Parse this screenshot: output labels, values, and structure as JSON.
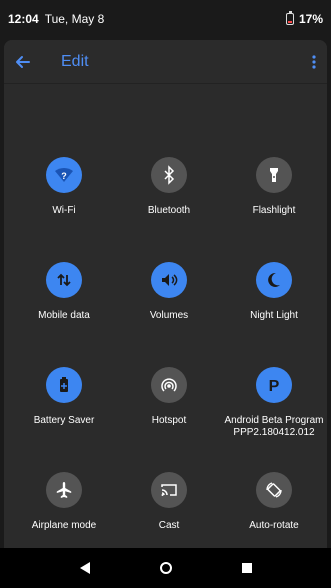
{
  "status_bar": {
    "time": "12:04",
    "date": "Tue, May 8",
    "battery": "17%"
  },
  "toolbar": {
    "title": "Edit"
  },
  "tiles": [
    {
      "label": "Wi-Fi",
      "icon": "wifi-icon",
      "active": true
    },
    {
      "label": "Bluetooth",
      "icon": "bluetooth-icon",
      "active": false
    },
    {
      "label": "Flashlight",
      "icon": "flashlight-icon",
      "active": false
    },
    {
      "label": "Mobile data",
      "icon": "mobile-data-icon",
      "active": true
    },
    {
      "label": "Volumes",
      "icon": "volume-icon",
      "active": true
    },
    {
      "label": "Night Light",
      "icon": "night-light-icon",
      "active": true
    },
    {
      "label": "Battery Saver",
      "icon": "battery-saver-icon",
      "active": true
    },
    {
      "label": "Hotspot",
      "icon": "hotspot-icon",
      "active": false
    },
    {
      "label": "Android Beta Program",
      "sublabel": "PPP2.180412.012",
      "icon": "beta-program-icon",
      "active": true
    },
    {
      "label": "Airplane mode",
      "icon": "airplane-icon",
      "active": false
    },
    {
      "label": "Cast",
      "icon": "cast-icon",
      "active": false
    },
    {
      "label": "Auto-rotate",
      "icon": "auto-rotate-icon",
      "active": false
    }
  ],
  "colors": {
    "accent": "#3d86f1",
    "inactive": "#545454",
    "panel": "#2b2b2b",
    "background": "#1a1a1a"
  }
}
